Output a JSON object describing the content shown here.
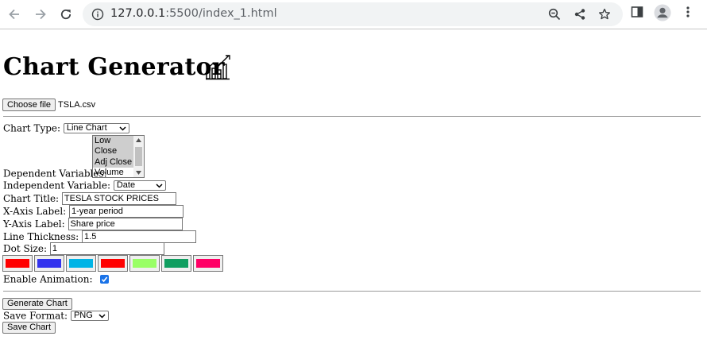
{
  "browser": {
    "url_host": "127.0.0.1",
    "url_rest": ":5500/index_1.html"
  },
  "page": {
    "title": "Chart Generator",
    "title_icon": "chart-growth-icon",
    "file_input": {
      "button_label": "Choose file",
      "file_name": "TSLA.csv"
    },
    "chart_type": {
      "label": "Chart Type:",
      "value": "Line Chart"
    },
    "dependent_variables": {
      "label": "Dependent Variables:",
      "options": [
        {
          "text": "Low",
          "selected": true
        },
        {
          "text": "Close",
          "selected": true
        },
        {
          "text": "Adj Close",
          "selected": true
        },
        {
          "text": "Volume",
          "selected": false
        }
      ]
    },
    "independent_variable": {
      "label": "Independent Variable:",
      "value": "Date"
    },
    "chart_title": {
      "label": "Chart Title:",
      "value": "TESLA STOCK PRICES"
    },
    "x_axis_label": {
      "label": "X-Axis Label:",
      "value": "1-year period"
    },
    "y_axis_label": {
      "label": "Y-Axis Label:",
      "value": "Share price"
    },
    "line_thickness": {
      "label": "Line Thickness:",
      "value": "1.5"
    },
    "dot_size": {
      "label": "Dot Size:",
      "value": "1"
    },
    "colors": [
      "#ff0000",
      "#3333ee",
      "#00b4e6",
      "#ff0000",
      "#99ff66",
      "#109e60",
      "#ff0066"
    ],
    "animation": {
      "label": "Enable Animation:",
      "checked": true
    },
    "generate_button": "Generate Chart",
    "save_format": {
      "label": "Save Format:",
      "value": "PNG"
    },
    "save_button": "Save Chart"
  }
}
